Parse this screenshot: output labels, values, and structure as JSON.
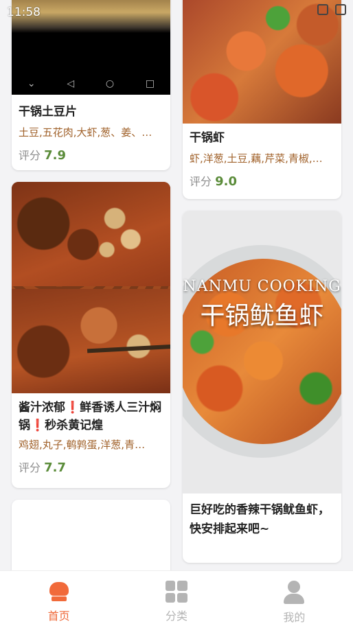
{
  "status_bar": {
    "time": "11:58"
  },
  "recipes": [
    {
      "title": "干锅土豆片",
      "ingredients": "土豆,五花肉,大虾,葱、姜、…",
      "rating_label": "评分",
      "rating": "7.9"
    },
    {
      "title": "干锅虾",
      "ingredients": "虾,洋葱,土豆,藕,芹菜,青椒,…",
      "rating_label": "评分",
      "rating": "9.0"
    },
    {
      "title": " 酱汁浓郁❗鲜香诱人三汁焖锅❗秒杀黄记煌",
      "ingredients": "鸡翅,丸子,鹌鹑蛋,洋葱,青…",
      "rating_label": "评分",
      "rating": "7.7"
    },
    {
      "title": "巨好吃的香辣干锅鱿鱼虾，快安排起来吧~",
      "image_text_en": "NANMU COOKING",
      "image_text_cn": "干锅鱿鱼虾"
    }
  ],
  "bottom_nav": [
    {
      "label": "首页",
      "icon": "chef-hat-icon",
      "active": true
    },
    {
      "label": "分类",
      "icon": "grid-icon",
      "active": false
    },
    {
      "label": "我的",
      "icon": "user-icon",
      "active": false
    }
  ],
  "colors": {
    "accent": "#ef6a3a",
    "ingredient": "#a0612a",
    "score": "#5b8c3a"
  }
}
